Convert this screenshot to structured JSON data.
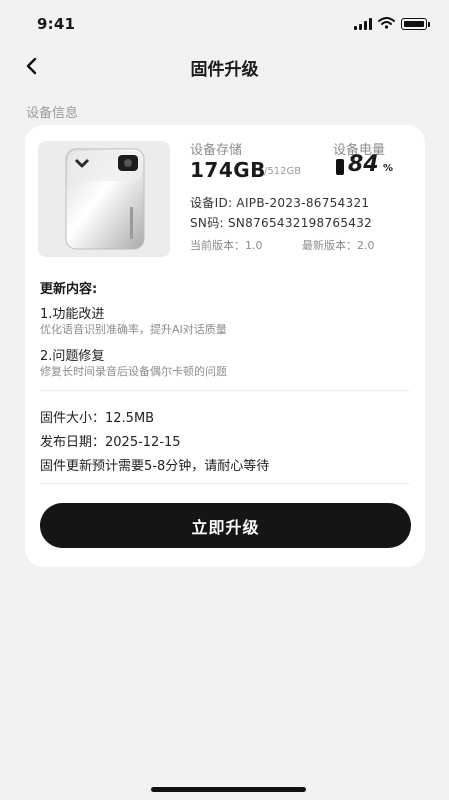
{
  "status_bar": {
    "time": "9:41"
  },
  "nav": {
    "title": "固件升级"
  },
  "section": {
    "label": "设备信息"
  },
  "device": {
    "storage_label": "设备存储",
    "storage_used": "174GB",
    "storage_total": "/512GB",
    "battery_label": "设备电量",
    "battery_percent": "84",
    "battery_unit": "%",
    "device_id": "设备ID: AIPB-2023-86754321",
    "sn": "SN码: SN8765432198765432",
    "current_version": "当前版本：1.0",
    "latest_version": "最新版本：2.0"
  },
  "update": {
    "title": "更新内容:",
    "items": [
      {
        "title": "1.功能改进",
        "desc": "优化语音识别准确率，提升AI对话质量"
      },
      {
        "title": "2.问题修复",
        "desc": "修复长时间录音后设备偶尔卡顿的问题"
      }
    ]
  },
  "firmware": {
    "size": "固件大小：12.5MB",
    "release_date": "发布日期：2025-12-15",
    "estimate": "固件更新预计需要5-8分钟，请耐心等待"
  },
  "actions": {
    "upgrade_label": "立即升级"
  },
  "colors": {
    "accent": "#151515",
    "background": "#f2f2f2",
    "card": "#ffffff",
    "muted": "#8c8c8c"
  }
}
